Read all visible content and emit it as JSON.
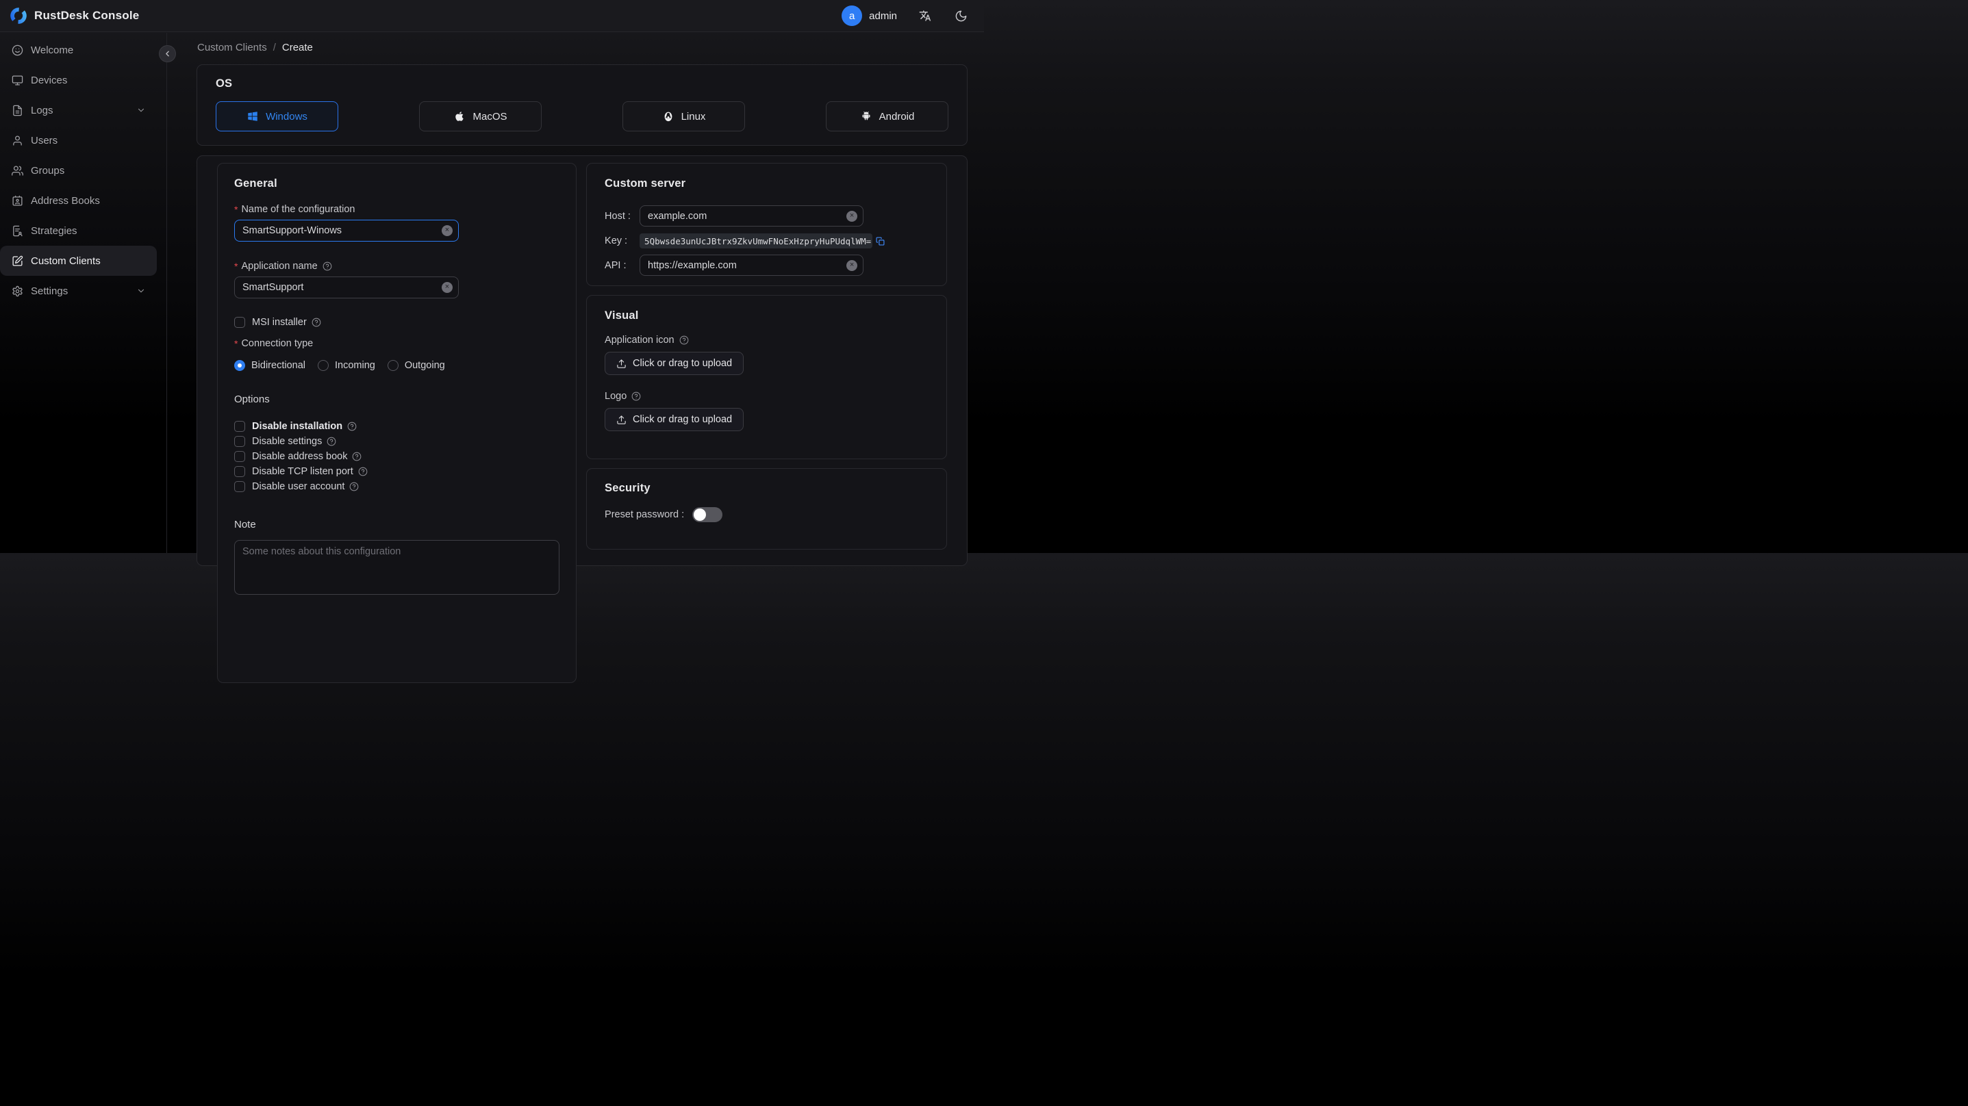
{
  "theme": {
    "accent": "#2b7af0",
    "danger": "#e5484d"
  },
  "header": {
    "app_title": "RustDesk Console",
    "username": "admin",
    "avatar_initial": "a"
  },
  "sidebar": {
    "items": [
      {
        "label": "Welcome"
      },
      {
        "label": "Devices"
      },
      {
        "label": "Logs"
      },
      {
        "label": "Users"
      },
      {
        "label": "Groups"
      },
      {
        "label": "Address Books"
      },
      {
        "label": "Strategies"
      },
      {
        "label": "Custom Clients"
      },
      {
        "label": "Settings"
      }
    ]
  },
  "breadcrumb": {
    "section": "Custom Clients",
    "separator": "/",
    "page": "Create"
  },
  "os": {
    "title": "OS",
    "options": [
      {
        "label": "Windows",
        "selected": true
      },
      {
        "label": "MacOS",
        "selected": false
      },
      {
        "label": "Linux",
        "selected": false
      },
      {
        "label": "Android",
        "selected": false
      }
    ]
  },
  "general": {
    "title": "General",
    "name_label": "Name of the configuration",
    "name_value": "SmartSupport-Winows",
    "app_name_label": "Application name",
    "app_name_value": "SmartSupport",
    "msi_label": "MSI installer",
    "connection_type_label": "Connection type",
    "connection_options": [
      {
        "label": "Bidirectional",
        "selected": true
      },
      {
        "label": "Incoming",
        "selected": false
      },
      {
        "label": "Outgoing",
        "selected": false
      }
    ],
    "options_title": "Options",
    "options": [
      {
        "label": "Disable installation"
      },
      {
        "label": "Disable settings"
      },
      {
        "label": "Disable address book"
      },
      {
        "label": "Disable TCP listen port"
      },
      {
        "label": "Disable user account"
      }
    ],
    "note_label": "Note",
    "note_placeholder": "Some notes about this configuration"
  },
  "custom_server": {
    "title": "Custom server",
    "host_label": "Host :",
    "host_value": "example.com",
    "key_label": "Key :",
    "key_value": "5Qbwsde3unUcJBtrx9ZkvUmwFNoExHzpryHuPUdqlWM=",
    "api_label": "API :",
    "api_value": "https://example.com"
  },
  "visual": {
    "title": "Visual",
    "app_icon_label": "Application icon",
    "logo_label": "Logo",
    "upload_label": "Click or drag to upload"
  },
  "security": {
    "title": "Security",
    "preset_password_label": "Preset password :"
  }
}
